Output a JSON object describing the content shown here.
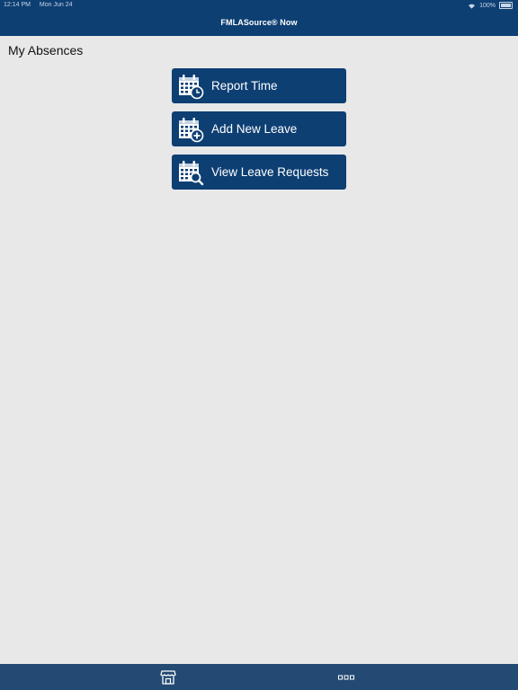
{
  "status_bar": {
    "time": "12:14 PM",
    "date": "Mon Jun 24",
    "battery": "100%"
  },
  "header": {
    "title": "FMLASource® Now"
  },
  "page": {
    "title": "My Absences"
  },
  "actions": [
    {
      "label": "Report Time",
      "icon": "calendar-clock-icon"
    },
    {
      "label": "Add New Leave",
      "icon": "calendar-add-icon"
    },
    {
      "label": "View Leave Requests",
      "icon": "calendar-search-icon"
    }
  ],
  "tab_bar": {
    "tabs": [
      {
        "icon": "store-icon"
      },
      {
        "icon": "more-icon"
      }
    ]
  },
  "colors": {
    "primary": "#0d3f73",
    "tab_bar": "#234a73",
    "background": "#e8e8e8"
  }
}
